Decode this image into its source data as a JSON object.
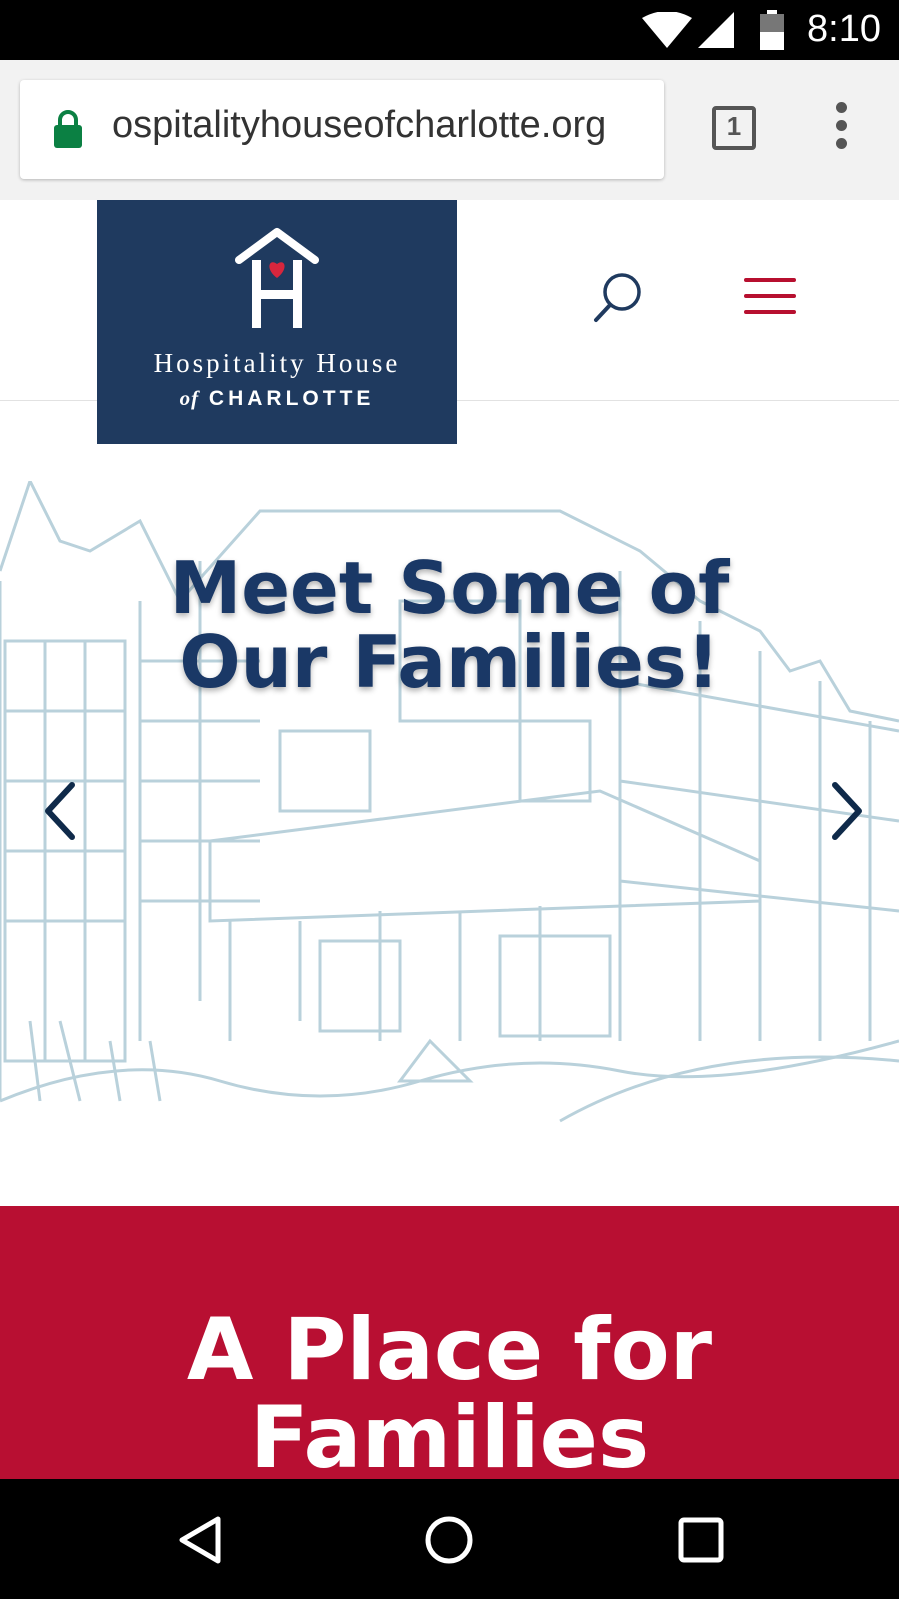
{
  "status_bar": {
    "time": "8:10"
  },
  "browser": {
    "url": "ospitalityhouseofcharlotte.org",
    "tab_count": "1"
  },
  "logo": {
    "line1": "Hospitality House",
    "line2_prefix": "of",
    "line2": "CHARLOTTE"
  },
  "hero": {
    "title_line1": "Meet Some of",
    "title_line2": "Our Families!"
  },
  "section": {
    "title_line1": "A Place for",
    "title_line2": "Families"
  },
  "colors": {
    "navy": "#1f3a5f",
    "red": "#b80f32",
    "title_blue": "#1a3866",
    "sketch": "#b9d1db",
    "lock_green": "#0b8043"
  },
  "icons": [
    "wifi-icon",
    "cell-signal-icon",
    "battery-icon",
    "lock-icon",
    "tab-switcher-icon",
    "more-options-icon",
    "search-icon",
    "hamburger-menu-icon",
    "chevron-left-icon",
    "chevron-right-icon",
    "back-icon",
    "home-icon",
    "recents-icon"
  ]
}
